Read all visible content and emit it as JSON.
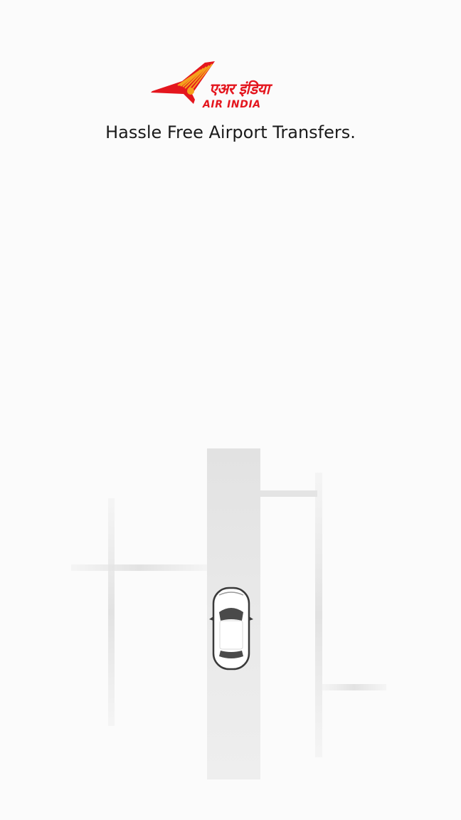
{
  "brand": {
    "logo_hindi": "एअर इंडिया",
    "logo_english": "AIR INDIA",
    "brand_color": "#e4161e"
  },
  "splash": {
    "tagline": "Hassle Free Airport Transfers."
  },
  "illustration": {
    "vehicle": "car-top-view-icon",
    "road_color": "#e6e6e6"
  }
}
